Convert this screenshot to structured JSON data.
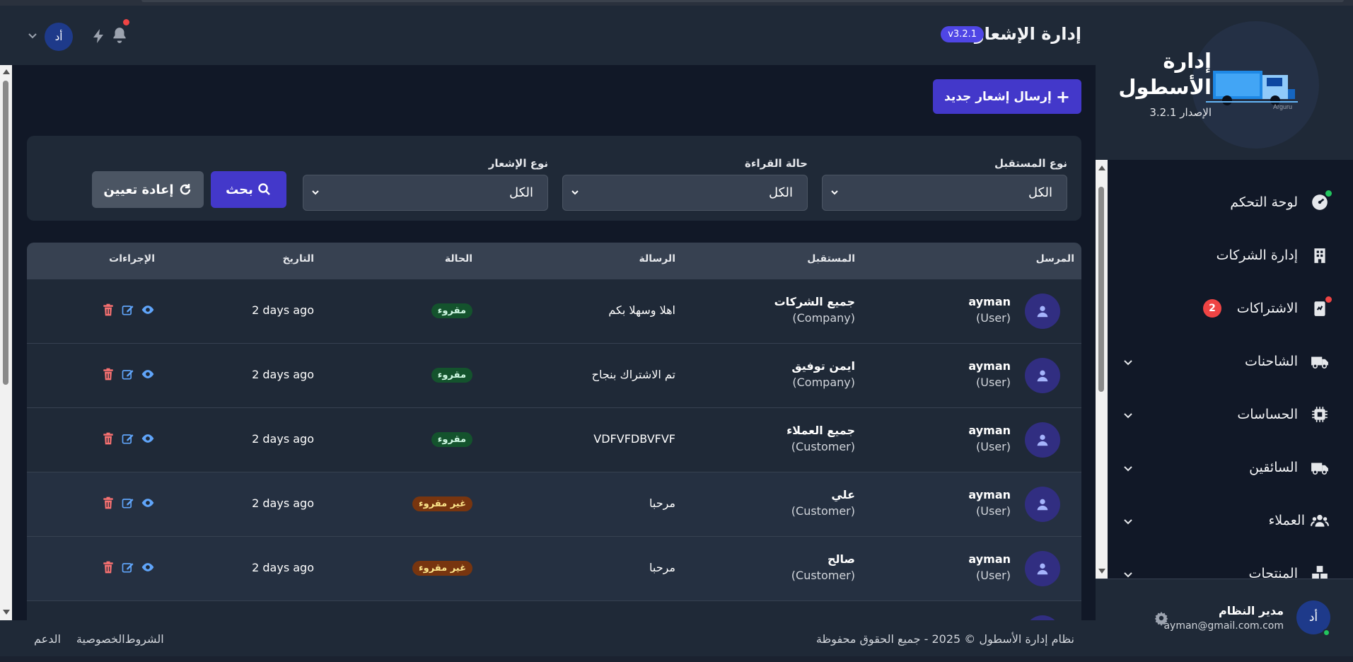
{
  "header": {
    "title": "إدارة الإشعارات",
    "version": "v3.2.1",
    "avatar_initials": "أد",
    "notification_dot": true
  },
  "actions": {
    "new_notification": "إرسال إشعار جديد"
  },
  "filters": {
    "recipient_type": {
      "label": "نوع المستقبل",
      "value": "الكل"
    },
    "read_status": {
      "label": "حالة القراءة",
      "value": "الكل"
    },
    "notification_type": {
      "label": "نوع الإشعار",
      "value": "الكل"
    },
    "search_label": "بحث",
    "reset_label": "إعادة تعيين"
  },
  "table": {
    "columns": [
      "المرسل",
      "المستقبل",
      "الرسالة",
      "الحالة",
      "التاريخ",
      "الإجراءات"
    ],
    "rows": [
      {
        "sender": "ayman",
        "sender_type": "(User)",
        "recipient": "جميع الشركات",
        "recipient_type": "(Company)",
        "message": "اهلا وسهلا بكم",
        "status": "مقروء",
        "status_kind": "read",
        "date": "2 days ago"
      },
      {
        "sender": "ayman",
        "sender_type": "(User)",
        "recipient": "ايمن توفيق",
        "recipient_type": "(Company)",
        "message": "تم الاشتراك بنجاح",
        "status": "مقروء",
        "status_kind": "read",
        "date": "2 days ago"
      },
      {
        "sender": "ayman",
        "sender_type": "(User)",
        "recipient": "جميع العملاء",
        "recipient_type": "(Customer)",
        "message": "VDFVFDBVFVF",
        "status": "مقروء",
        "status_kind": "read",
        "date": "2 days ago"
      },
      {
        "sender": "ayman",
        "sender_type": "(User)",
        "recipient": "علي",
        "recipient_type": "(Customer)",
        "message": "مرحبا",
        "status": "غير مقروء",
        "status_kind": "unread",
        "date": "2 days ago"
      },
      {
        "sender": "ayman",
        "sender_type": "(User)",
        "recipient": "صالح",
        "recipient_type": "(Customer)",
        "message": "مرحبا",
        "status": "غير مقروء",
        "status_kind": "unread",
        "date": "2 days ago"
      }
    ]
  },
  "footer": {
    "copyright": "نظام إدارة الأسطول © 2025 - جميع الحقوق محفوظة",
    "links": [
      "الشروط",
      "الخصوصية",
      "الدعم"
    ]
  },
  "sidebar": {
    "brand": "إدارة الأسطول",
    "version": "الإصدار 3.2.1",
    "logo_text": "Arguru",
    "items": [
      {
        "label": "لوحة التحكم",
        "icon": "dashboard-icon",
        "dot": "green"
      },
      {
        "label": "إدارة الشركات",
        "icon": "building-icon"
      },
      {
        "label": "الاشتراكات",
        "icon": "subscription-icon",
        "dot": "red",
        "count": "2"
      },
      {
        "label": "الشاحنات",
        "icon": "truck-icon",
        "expandable": true
      },
      {
        "label": "الحساسات",
        "icon": "sensor-chip-icon",
        "expandable": true
      },
      {
        "label": "السائقين",
        "icon": "truck-driver-icon",
        "expandable": true
      },
      {
        "label": "العملاء",
        "icon": "users-icon",
        "expandable": true
      },
      {
        "label": "المنتجات",
        "icon": "boxes-icon",
        "expandable": true
      }
    ],
    "user": {
      "name": "مدير النظام",
      "email": "ayman@gmail.com.com",
      "initials": "أد"
    }
  },
  "colors": {
    "accent": "#4338ca",
    "read": "#14532d",
    "unread": "#78350f",
    "danger": "#ef4444",
    "online": "#22c55e"
  }
}
